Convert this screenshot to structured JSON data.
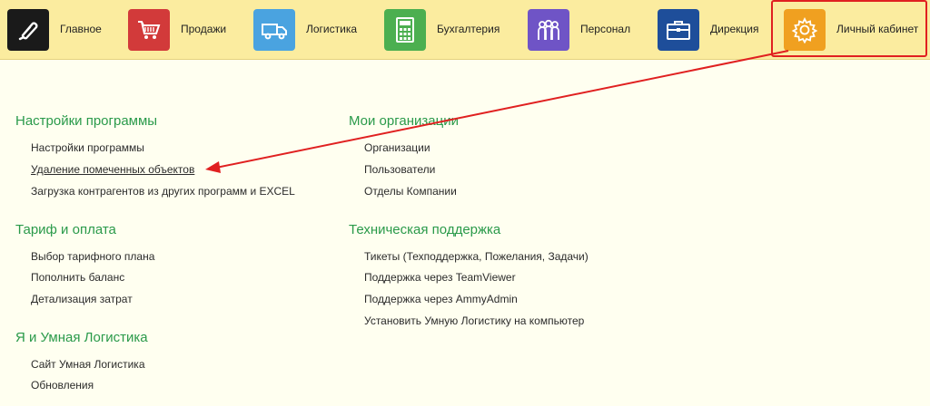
{
  "topnav": {
    "items": [
      {
        "label": "Главное",
        "icon": "pen-logo-icon",
        "color": "#1a1a1a"
      },
      {
        "label": "Продажи",
        "icon": "shopping-cart-icon",
        "color": "#d23a3a"
      },
      {
        "label": "Логистика",
        "icon": "truck-icon",
        "color": "#4aa3e0"
      },
      {
        "label": "Бухгалтерия",
        "icon": "calculator-icon",
        "color": "#4caf50"
      },
      {
        "label": "Персонал",
        "icon": "people-icon",
        "color": "#6f54c6"
      },
      {
        "label": "Дирекция",
        "icon": "briefcase-icon",
        "color": "#1e4e9a"
      },
      {
        "label": "Личный кабинет",
        "icon": "gear-icon",
        "color": "#f0a020"
      }
    ]
  },
  "colors": {
    "section_title": "#2a9a4a",
    "topbar": "#fbec9f",
    "highlight": "#e02020"
  },
  "sections": {
    "settings": {
      "title": "Настройки программы",
      "links": [
        "Настройки программы",
        "Удаление помеченных объектов",
        "Загрузка контрагентов из других программ и EXCEL"
      ]
    },
    "tariff": {
      "title": "Тариф и оплата",
      "links": [
        "Выбор тарифного плана",
        "Пополнить баланс",
        "Детализация затрат"
      ]
    },
    "smart": {
      "title": "Я и Умная Логистика",
      "links": [
        "Сайт Умная Логистика",
        "Обновления"
      ]
    },
    "orgs": {
      "title": "Мои организации",
      "links": [
        "Организации",
        "Пользователи",
        "Отделы Компании"
      ]
    },
    "support": {
      "title": "Техническая поддержка",
      "links": [
        "Тикеты (Техподдержка, Пожелания, Задачи)",
        "Поддержка через TeamViewer",
        "Поддержка через AmmyAdmin",
        "Установить Умную Логистику на компьютер"
      ]
    }
  }
}
